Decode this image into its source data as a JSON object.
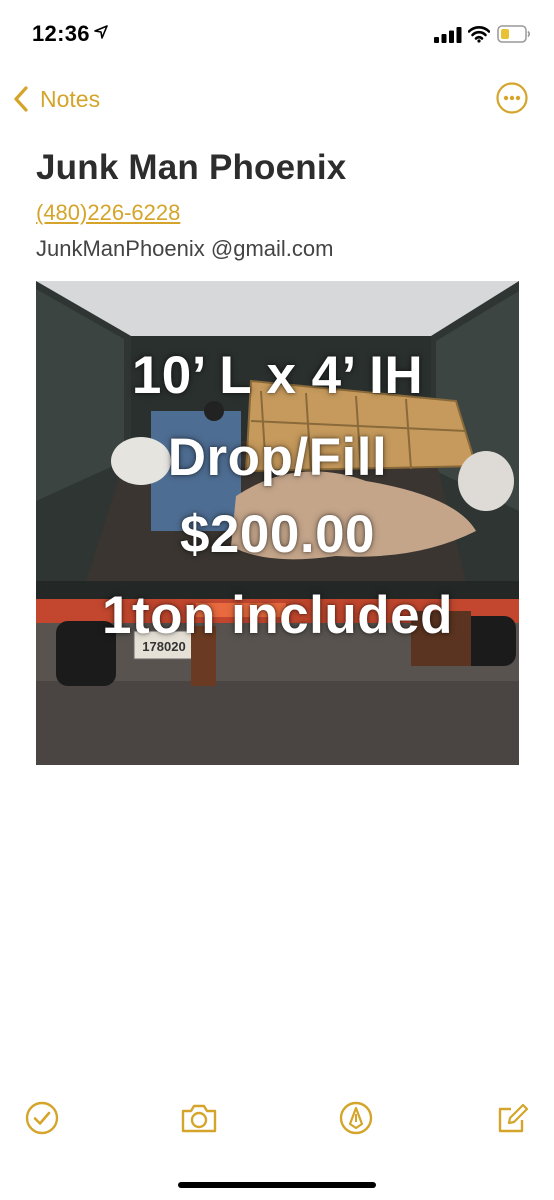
{
  "status_bar": {
    "time": "12:36"
  },
  "nav": {
    "back_label": "Notes"
  },
  "note": {
    "title": "Junk Man Phoenix",
    "phone": "(480)226-6228",
    "email": "JunkManPhoenix @gmail.com",
    "photo": {
      "overlay_lines": [
        "10’ L x 4’ IH",
        "Drop/Fill",
        "$200.00",
        "1ton included"
      ],
      "license_plate": "178020"
    }
  },
  "colors": {
    "accent": "#d4a52a",
    "title": "#2d2d2d"
  },
  "toolbar": {
    "icons": [
      "checklist-icon",
      "camera-icon",
      "markup-icon",
      "compose-icon"
    ]
  }
}
